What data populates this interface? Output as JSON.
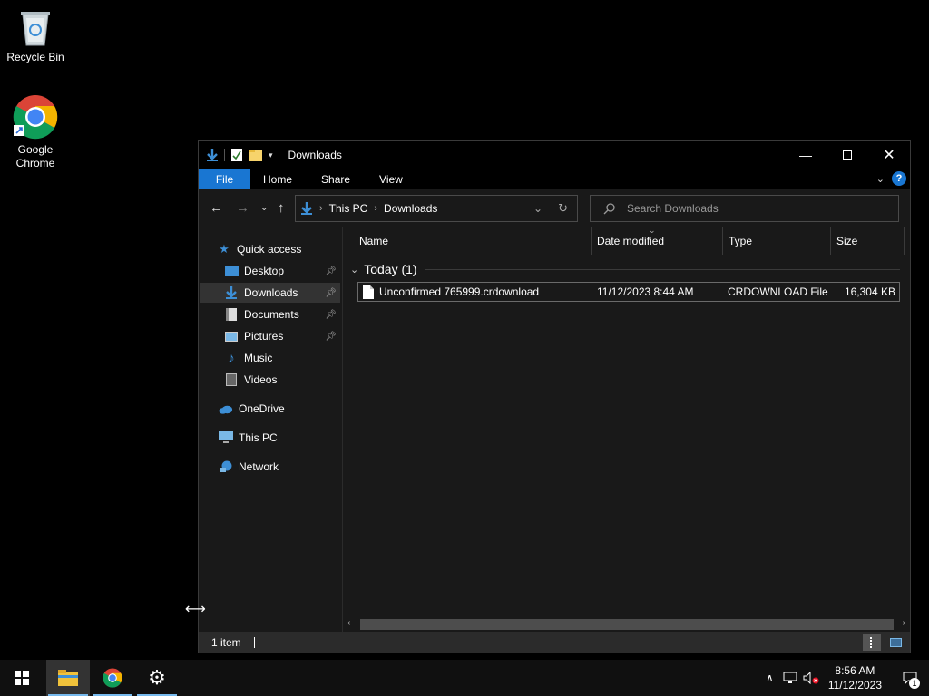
{
  "desktop": {
    "recycle_bin": "Recycle Bin",
    "chrome": "Google Chrome"
  },
  "window": {
    "title": "Downloads",
    "ribbon": {
      "file": "File",
      "home": "Home",
      "share": "Share",
      "view": "View"
    },
    "address": {
      "crumb1": "This PC",
      "crumb2": "Downloads"
    },
    "search_placeholder": "Search Downloads",
    "nav": {
      "quick_access": "Quick access",
      "desktop": "Desktop",
      "downloads": "Downloads",
      "documents": "Documents",
      "pictures": "Pictures",
      "music": "Music",
      "videos": "Videos",
      "onedrive": "OneDrive",
      "this_pc": "This PC",
      "network": "Network"
    },
    "columns": {
      "name": "Name",
      "date": "Date modified",
      "type": "Type",
      "size": "Size"
    },
    "group": "Today (1)",
    "file": {
      "name": "Unconfirmed 765999.crdownload",
      "date": "11/12/2023 8:44 AM",
      "type": "CRDOWNLOAD File",
      "size": "16,304 KB"
    },
    "status": "1 item"
  },
  "taskbar": {
    "time": "8:56 AM",
    "date": "11/12/2023",
    "notification_count": "1"
  },
  "colors": {
    "accent": "#1976d2",
    "folder": "#f0c23b"
  }
}
